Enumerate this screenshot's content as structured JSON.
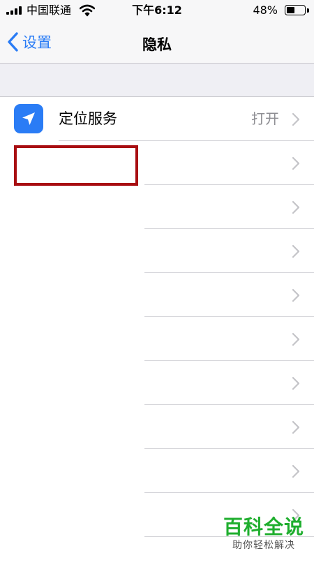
{
  "status_bar": {
    "carrier": "中国联通",
    "time": "下午6:12",
    "battery_percent": "48%",
    "battery_level": 0.48
  },
  "nav": {
    "back_label": "设置",
    "title": "隐私"
  },
  "list": {
    "items": [
      {
        "label": "定位服务",
        "value": "打开",
        "icon": "location-arrow-icon",
        "icon_color": "#2a7cf5"
      },
      {
        "label": "",
        "value": ""
      },
      {
        "label": "",
        "value": ""
      },
      {
        "label": "",
        "value": ""
      },
      {
        "label": "",
        "value": ""
      },
      {
        "label": "",
        "value": ""
      },
      {
        "label": "",
        "value": ""
      },
      {
        "label": "",
        "value": ""
      },
      {
        "label": "",
        "value": ""
      },
      {
        "label": "",
        "value": ""
      },
      {
        "label": "",
        "value": ""
      }
    ]
  },
  "annotation": {
    "highlight_color": "#a80d12"
  },
  "watermark": {
    "title": "百科全说",
    "subtitle": "助你轻松解决"
  },
  "colors": {
    "accent": "#2a7cf5",
    "watermark_green": "#1fae2e",
    "separator": "#d1d1d6",
    "group_background": "#efeff4"
  }
}
